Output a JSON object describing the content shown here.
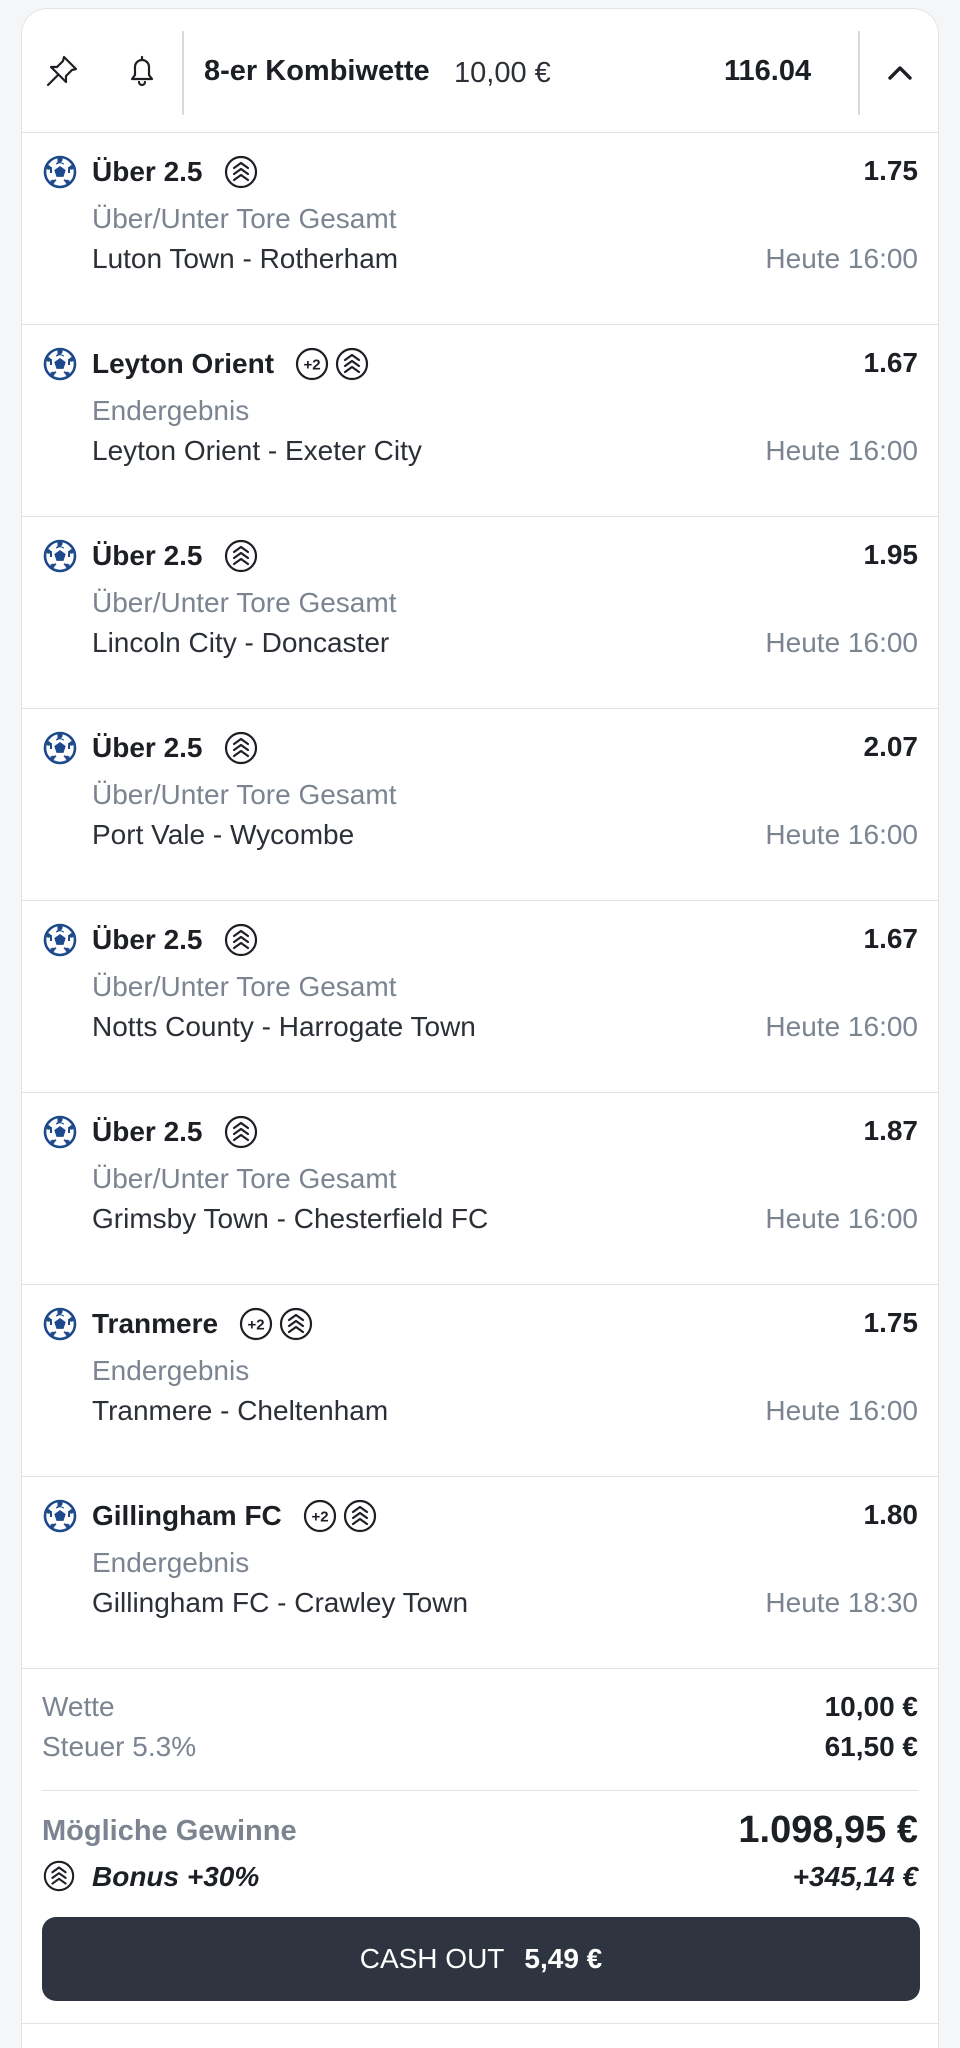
{
  "header": {
    "title": "8-er Kombiwette",
    "stake": "10,00 €",
    "total_odds": "116.04",
    "icons": [
      "pin-icon",
      "bell-icon",
      "chevron-up-icon"
    ]
  },
  "bets": [
    {
      "selection": "Über 2.5",
      "badges": [
        "boost-icon"
      ],
      "odds": "1.75",
      "market": "Über/Unter Tore Gesamt",
      "match": "Luton Town - Rotherham",
      "time": "Heute 16:00"
    },
    {
      "selection": "Leyton Orient",
      "badges": [
        "plus2-icon",
        "boost-icon"
      ],
      "odds": "1.67",
      "market": "Endergebnis",
      "match": "Leyton Orient - Exeter City",
      "time": "Heute 16:00"
    },
    {
      "selection": "Über 2.5",
      "badges": [
        "boost-icon"
      ],
      "odds": "1.95",
      "market": "Über/Unter Tore Gesamt",
      "match": "Lincoln City - Doncaster",
      "time": "Heute 16:00"
    },
    {
      "selection": "Über 2.5",
      "badges": [
        "boost-icon"
      ],
      "odds": "2.07",
      "market": "Über/Unter Tore Gesamt",
      "match": "Port Vale - Wycombe",
      "time": "Heute 16:00"
    },
    {
      "selection": "Über 2.5",
      "badges": [
        "boost-icon"
      ],
      "odds": "1.67",
      "market": "Über/Unter Tore Gesamt",
      "match": "Notts County - Harrogate Town",
      "time": "Heute 16:00"
    },
    {
      "selection": "Über 2.5",
      "badges": [
        "boost-icon"
      ],
      "odds": "1.87",
      "market": "Über/Unter Tore Gesamt",
      "match": "Grimsby Town - Chesterfield FC",
      "time": "Heute 16:00"
    },
    {
      "selection": "Tranmere",
      "badges": [
        "plus2-icon",
        "boost-icon"
      ],
      "odds": "1.75",
      "market": "Endergebnis",
      "match": "Tranmere - Cheltenham",
      "time": "Heute 16:00"
    },
    {
      "selection": "Gillingham FC",
      "badges": [
        "plus2-icon",
        "boost-icon"
      ],
      "odds": "1.80",
      "market": "Endergebnis",
      "match": "Gillingham FC - Crawley Town",
      "time": "Heute 18:30"
    }
  ],
  "summary": {
    "stake_label": "Wette",
    "stake_value": "10,00 €",
    "tax_label": "Steuer 5.3%",
    "tax_value": "61,50 €",
    "winnings_label": "Mögliche Gewinne",
    "winnings_value": "1.098,95 €",
    "bonus_label": "Bonus +30%",
    "bonus_value": "+345,14 €"
  },
  "cashout": {
    "label": "CASH OUT",
    "amount": "5,49 €"
  },
  "colors": {
    "ball_blue": "#1e4a8c",
    "button_dark": "#2e3440",
    "muted_text": "#7b8490"
  }
}
